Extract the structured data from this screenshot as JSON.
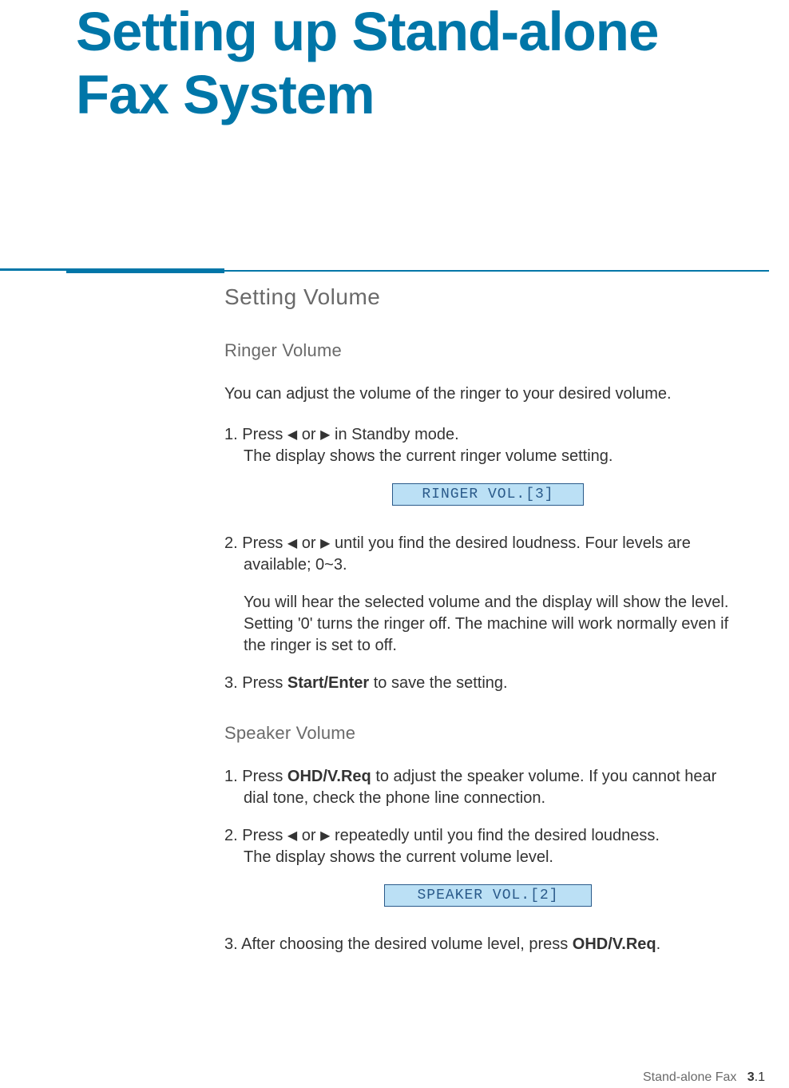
{
  "title": "Setting up Stand-alone Fax System",
  "section": {
    "heading": "Setting Volume",
    "ringer": {
      "heading": "Ringer Volume",
      "intro": "You can adjust the volume of the ringer to your desired volume.",
      "step1_a": "1. Press ",
      "step1_b": " or ",
      "step1_c": " in Standby mode.",
      "step1_line2": "The display shows the current ringer volume setting.",
      "lcd": "RINGER VOL.[3]",
      "step2_a": "2. Press ",
      "step2_b": " or ",
      "step2_c": " until you find the desired loudness. Four levels are",
      "step2_line2": "available; 0~3.",
      "step2_para2_l1": "You will hear the selected volume and the display will show the level.",
      "step2_para2_l2": "Setting '0' turns the ringer off. The machine will work normally even if",
      "step2_para2_l3": "the ringer is set to off.",
      "step3_a": "3. Press ",
      "step3_bold": "Start/Enter",
      "step3_b": " to save the setting."
    },
    "speaker": {
      "heading": "Speaker Volume",
      "step1_a": "1. Press ",
      "step1_bold": "OHD/V.Req",
      "step1_b": " to adjust the speaker volume. If you cannot hear",
      "step1_line2": "dial tone, check the phone line connection.",
      "step2_a": "2. Press ",
      "step2_b": " or ",
      "step2_c": " repeatedly until you find the desired loudness.",
      "step2_line2": "The display shows the current volume level.",
      "lcd": "SPEAKER VOL.[2]",
      "step3_a": "3. After choosing the desired volume level, press ",
      "step3_bold": "OHD/V.Req",
      "step3_b": "."
    }
  },
  "footer": {
    "label": "Stand-alone Fax",
    "page_chapter": "3",
    "page_sep": ".",
    "page_num": "1"
  },
  "glyphs": {
    "left_arrow": "➛",
    "right_arrow": "➛"
  }
}
